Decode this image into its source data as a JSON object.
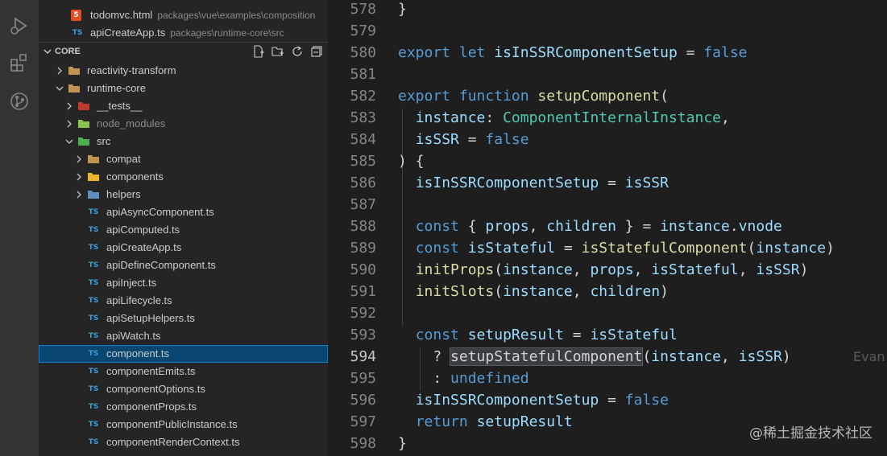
{
  "explorer": {
    "open_editors": [
      {
        "label": "todomvc.html",
        "desc": "packages\\vue\\examples\\composition",
        "icon": "html5"
      },
      {
        "label": "apiCreateApp.ts",
        "desc": "packages\\runtime-core\\src",
        "icon": "ts"
      }
    ],
    "section_title": "CORE",
    "tree": [
      {
        "label": "reactivity-transform",
        "depth": 1,
        "kind": "folder",
        "expanded": false
      },
      {
        "label": "runtime-core",
        "depth": 1,
        "kind": "folder",
        "expanded": true
      },
      {
        "label": "__tests__",
        "depth": 2,
        "kind": "tests-folder",
        "expanded": false
      },
      {
        "label": "node_modules",
        "depth": 2,
        "kind": "node-folder",
        "expanded": false,
        "dim": true
      },
      {
        "label": "src",
        "depth": 2,
        "kind": "src-folder",
        "expanded": true
      },
      {
        "label": "compat",
        "depth": 3,
        "kind": "folder",
        "expanded": false
      },
      {
        "label": "components",
        "depth": 3,
        "kind": "components-folder",
        "expanded": false
      },
      {
        "label": "helpers",
        "depth": 3,
        "kind": "helpers-folder",
        "expanded": false
      },
      {
        "label": "apiAsyncComponent.ts",
        "depth": 3,
        "kind": "ts"
      },
      {
        "label": "apiComputed.ts",
        "depth": 3,
        "kind": "ts"
      },
      {
        "label": "apiCreateApp.ts",
        "depth": 3,
        "kind": "ts"
      },
      {
        "label": "apiDefineComponent.ts",
        "depth": 3,
        "kind": "ts"
      },
      {
        "label": "apiInject.ts",
        "depth": 3,
        "kind": "ts"
      },
      {
        "label": "apiLifecycle.ts",
        "depth": 3,
        "kind": "ts"
      },
      {
        "label": "apiSetupHelpers.ts",
        "depth": 3,
        "kind": "ts"
      },
      {
        "label": "apiWatch.ts",
        "depth": 3,
        "kind": "ts"
      },
      {
        "label": "component.ts",
        "depth": 3,
        "kind": "ts",
        "selected": true
      },
      {
        "label": "componentEmits.ts",
        "depth": 3,
        "kind": "ts"
      },
      {
        "label": "componentOptions.ts",
        "depth": 3,
        "kind": "ts"
      },
      {
        "label": "componentProps.ts",
        "depth": 3,
        "kind": "ts"
      },
      {
        "label": "componentPublicInstance.ts",
        "depth": 3,
        "kind": "ts"
      },
      {
        "label": "componentRenderContext.ts",
        "depth": 3,
        "kind": "ts"
      }
    ],
    "ts_badge": "TS"
  },
  "editor": {
    "current_line": "594",
    "lines": [
      {
        "n": "578",
        "t": [
          [
            "op",
            "}"
          ]
        ]
      },
      {
        "n": "579",
        "t": []
      },
      {
        "n": "580",
        "t": [
          [
            "kw",
            "export"
          ],
          [
            "op",
            " "
          ],
          [
            "kw",
            "let"
          ],
          [
            "op",
            " "
          ],
          [
            "vr",
            "isInSSRComponentSetup"
          ],
          [
            "op",
            " = "
          ],
          [
            "kw",
            "false"
          ]
        ]
      },
      {
        "n": "581",
        "t": []
      },
      {
        "n": "582",
        "t": [
          [
            "kw",
            "export"
          ],
          [
            "op",
            " "
          ],
          [
            "kw",
            "function"
          ],
          [
            "op",
            " "
          ],
          [
            "fn",
            "setupComponent"
          ],
          [
            "op",
            "("
          ]
        ]
      },
      {
        "n": "583",
        "t": [
          [
            "op",
            "  "
          ],
          [
            "vr",
            "instance"
          ],
          [
            "op",
            ": "
          ],
          [
            "ty",
            "ComponentInternalInstance"
          ],
          [
            "op",
            ","
          ]
        ]
      },
      {
        "n": "584",
        "t": [
          [
            "op",
            "  "
          ],
          [
            "vr",
            "isSSR"
          ],
          [
            "op",
            " = "
          ],
          [
            "kw",
            "false"
          ]
        ]
      },
      {
        "n": "585",
        "t": [
          [
            "op",
            ") {"
          ]
        ]
      },
      {
        "n": "586",
        "t": [
          [
            "op",
            "  "
          ],
          [
            "vr",
            "isInSSRComponentSetup"
          ],
          [
            "op",
            " = "
          ],
          [
            "vr",
            "isSSR"
          ]
        ]
      },
      {
        "n": "587",
        "t": []
      },
      {
        "n": "588",
        "t": [
          [
            "op",
            "  "
          ],
          [
            "kw",
            "const"
          ],
          [
            "op",
            " { "
          ],
          [
            "vr",
            "props"
          ],
          [
            "op",
            ", "
          ],
          [
            "vr",
            "children"
          ],
          [
            "op",
            " } = "
          ],
          [
            "vr",
            "instance"
          ],
          [
            "op",
            "."
          ],
          [
            "vr",
            "vnode"
          ]
        ]
      },
      {
        "n": "589",
        "t": [
          [
            "op",
            "  "
          ],
          [
            "kw",
            "const"
          ],
          [
            "op",
            " "
          ],
          [
            "vr",
            "isStateful"
          ],
          [
            "op",
            " = "
          ],
          [
            "fn",
            "isStatefulComponent"
          ],
          [
            "op",
            "("
          ],
          [
            "vr",
            "instance"
          ],
          [
            "op",
            ")"
          ]
        ]
      },
      {
        "n": "590",
        "t": [
          [
            "op",
            "  "
          ],
          [
            "fn",
            "initProps"
          ],
          [
            "op",
            "("
          ],
          [
            "vr",
            "instance"
          ],
          [
            "op",
            ", "
          ],
          [
            "vr",
            "props"
          ],
          [
            "op",
            ", "
          ],
          [
            "vr",
            "isStateful"
          ],
          [
            "op",
            ", "
          ],
          [
            "vr",
            "isSSR"
          ],
          [
            "op",
            ")"
          ]
        ]
      },
      {
        "n": "591",
        "t": [
          [
            "op",
            "  "
          ],
          [
            "fn",
            "initSlots"
          ],
          [
            "op",
            "("
          ],
          [
            "vr",
            "instance"
          ],
          [
            "op",
            ", "
          ],
          [
            "vr",
            "children"
          ],
          [
            "op",
            ")"
          ]
        ]
      },
      {
        "n": "592",
        "t": []
      },
      {
        "n": "593",
        "t": [
          [
            "op",
            "  "
          ],
          [
            "kw",
            "const"
          ],
          [
            "op",
            " "
          ],
          [
            "vr",
            "setupResult"
          ],
          [
            "op",
            " = "
          ],
          [
            "vr",
            "isStateful"
          ]
        ]
      },
      {
        "n": "594",
        "t": [
          [
            "op",
            "    ? "
          ],
          [
            "hl",
            "setupStatefulComponent"
          ],
          [
            "op",
            "("
          ],
          [
            "vr",
            "instance"
          ],
          [
            "op",
            ", "
          ],
          [
            "vr",
            "isSSR"
          ],
          [
            "op",
            ")"
          ]
        ],
        "ghost": "Evan"
      },
      {
        "n": "595",
        "t": [
          [
            "op",
            "    : "
          ],
          [
            "kw",
            "undefined"
          ]
        ]
      },
      {
        "n": "596",
        "t": [
          [
            "op",
            "  "
          ],
          [
            "vr",
            "isInSSRComponentSetup"
          ],
          [
            "op",
            " = "
          ],
          [
            "kw",
            "false"
          ]
        ]
      },
      {
        "n": "597",
        "t": [
          [
            "op",
            "  "
          ],
          [
            "kw",
            "return"
          ],
          [
            "op",
            " "
          ],
          [
            "vr",
            "setupResult"
          ]
        ]
      },
      {
        "n": "598",
        "t": [
          [
            "op",
            "}"
          ]
        ]
      }
    ]
  },
  "watermark": "@稀土掘金技术社区",
  "colors": {
    "selection": "#094771",
    "accent": "#007fd4",
    "keyword": "#569cd6",
    "function": "#dcdcaa",
    "variable": "#9cdcfe",
    "type": "#4ec9b0"
  }
}
